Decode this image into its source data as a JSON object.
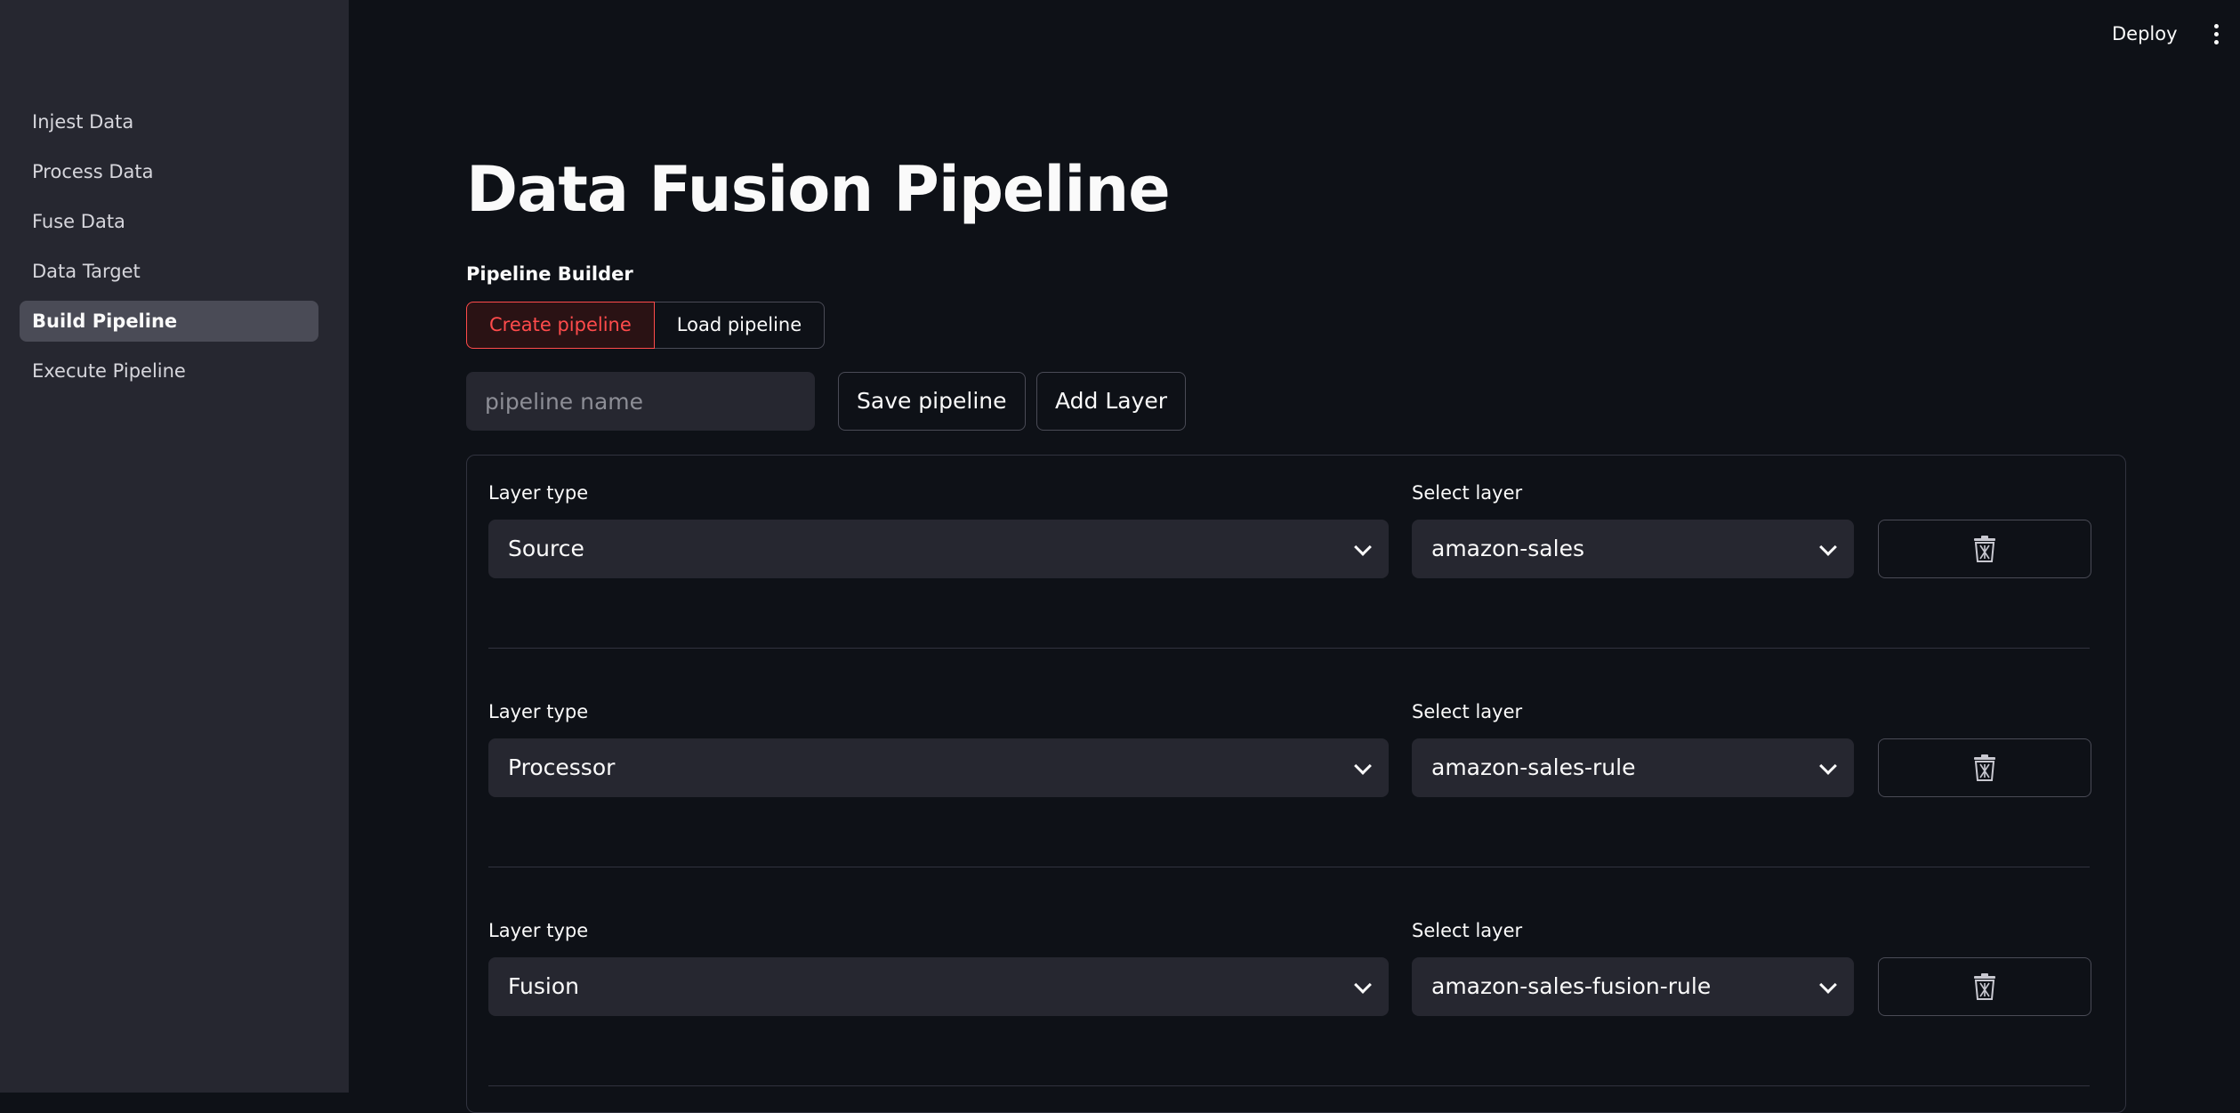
{
  "sidebar": {
    "items": [
      {
        "label": "Injest Data"
      },
      {
        "label": "Process Data"
      },
      {
        "label": "Fuse Data"
      },
      {
        "label": "Data Target"
      },
      {
        "label": "Build Pipeline",
        "active": true
      },
      {
        "label": "Execute Pipeline"
      }
    ]
  },
  "toolbar": {
    "deploy_label": "Deploy",
    "menu_icon": "vertical-dots-icon"
  },
  "main": {
    "title": "Data Fusion Pipeline",
    "builder_label": "Pipeline Builder",
    "mode_tabs": [
      {
        "label": "Create pipeline",
        "active": true
      },
      {
        "label": "Load pipeline",
        "active": false
      }
    ],
    "pipeline_name": {
      "value": "",
      "placeholder": "pipeline name"
    },
    "save_label": "Save pipeline",
    "add_layer_label": "Add Layer"
  },
  "layers": {
    "layer_type_label": "Layer type",
    "select_layer_label": "Select layer",
    "delete_icon": "trash-icon",
    "rows": [
      {
        "type": "Source",
        "layer": "amazon-sales"
      },
      {
        "type": "Processor",
        "layer": "amazon-sales-rule"
      },
      {
        "type": "Fusion",
        "layer": "amazon-sales-fusion-rule"
      }
    ]
  },
  "colors": {
    "background": "#0e1117",
    "sidebar": "#262730",
    "accent": "#ff4b4b",
    "input": "#262730",
    "border": "#4a4b56"
  }
}
